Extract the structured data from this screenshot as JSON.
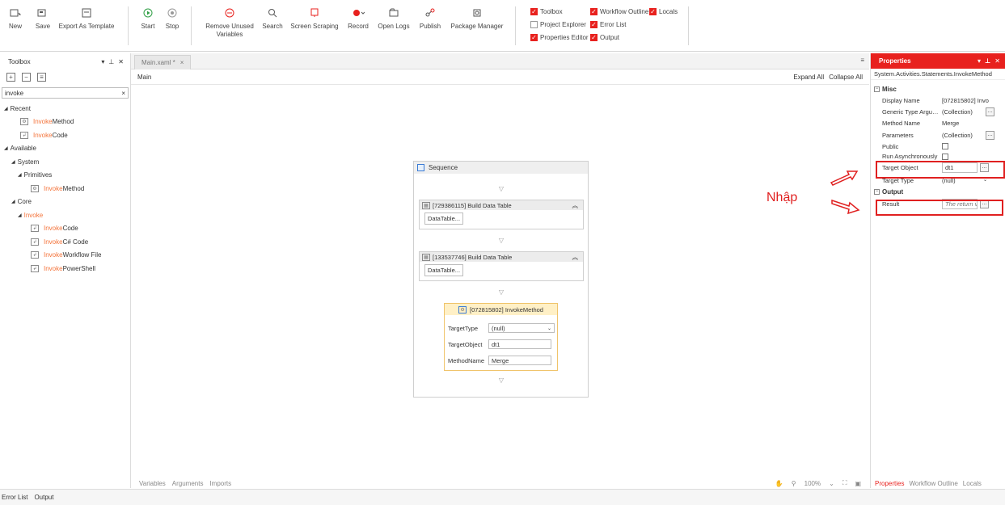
{
  "ribbon": {
    "new_label": "New",
    "save_label": "Save",
    "export_label": "Export As Template",
    "start_label": "Start",
    "stop_label": "Stop",
    "remove_unused_label": "Remove Unused Variables",
    "search_label": "Search",
    "screen_scraping_label": "Screen Scraping",
    "record_label": "Record",
    "open_logs_label": "Open Logs",
    "publish_label": "Publish",
    "package_manager_label": "Package Manager",
    "panels": [
      {
        "label": "Toolbox",
        "checked": true
      },
      {
        "label": "Workflow Outline",
        "checked": true
      },
      {
        "label": "Locals",
        "checked": true
      },
      {
        "label": "Project Explorer",
        "checked": false
      },
      {
        "label": "Error List",
        "checked": true
      },
      {
        "label": "Properties Editor",
        "checked": true
      },
      {
        "label": "Output",
        "checked": true
      }
    ],
    "accent_color": "#e8211e"
  },
  "toolbox": {
    "title": "Toolbox",
    "search_value": "invoke",
    "clear_glyph": "×",
    "tree": {
      "recent": "Recent",
      "recent_items": [
        {
          "hl": "Invoke",
          "rest": "Method",
          "icon": "invoke-method-icon"
        },
        {
          "hl": "Invoke",
          "rest": " Code",
          "icon": "invoke-code-icon"
        }
      ],
      "available": "Available",
      "system": "System",
      "primitives": "Primitives",
      "primitive_items": [
        {
          "hl": "Invoke",
          "rest": "Method",
          "icon": "invoke-method-icon"
        }
      ],
      "core": "Core",
      "invoke_group": "Invoke",
      "invoke_items": [
        {
          "hl": "Invoke",
          "rest": " Code",
          "icon": "invoke-code-icon"
        },
        {
          "hl": "Invoke",
          "rest": " C# Code",
          "icon": "invoke-csharp-icon"
        },
        {
          "hl": "Invoke",
          "rest": " Workflow File",
          "icon": "invoke-workflow-icon"
        },
        {
          "hl": "Invoke",
          "rest": " PowerShell",
          "icon": "invoke-powershell-icon"
        }
      ]
    }
  },
  "designer": {
    "tab_label": "Main.xaml *",
    "tab_close": "×",
    "breadcrumb": "Main",
    "expand_all": "Expand All",
    "collapse_all": "Collapse All",
    "sequence_title": "Sequence",
    "build_dt_1": "[729386115] Build Data Table",
    "build_dt_2": "[133537746] Build Data Table",
    "datatable_btn": "DataTable...",
    "invoke_title": "[072815802] InvokeMethod",
    "target_type_label": "TargetType",
    "target_type_value": "(null)",
    "target_object_label": "TargetObject",
    "target_object_value": "dt1",
    "method_name_label": "MethodName",
    "method_name_value": "Merge",
    "footer_tabs": [
      "Variables",
      "Arguments",
      "Imports"
    ],
    "zoom": "100%"
  },
  "properties": {
    "title": "Properties",
    "type": "System.Activities.Statements.InvokeMethod",
    "misc_label": "Misc",
    "rows": [
      {
        "name": "Display Name",
        "value": "[072815802] Invo"
      },
      {
        "name": "Generic Type Argume...",
        "value": "(Collection)"
      },
      {
        "name": "Method Name",
        "value": "Merge"
      },
      {
        "name": "Parameters",
        "value": "(Collection)"
      },
      {
        "name": "Public",
        "value": ""
      },
      {
        "name": "Run Asynchronously",
        "value": ""
      },
      {
        "name": "Target Object",
        "value": "dt1"
      },
      {
        "name": "Target Type",
        "value": "(null)"
      }
    ],
    "output_label": "Output",
    "result_label": "Result",
    "result_placeholder": "The return v",
    "footer_tabs": [
      "Properties",
      "Workflow Outline",
      "Locals"
    ]
  },
  "bottom_tabs": [
    "Error List",
    "Output"
  ],
  "annotation": {
    "label": "Nhập",
    "color": "#e02020"
  }
}
